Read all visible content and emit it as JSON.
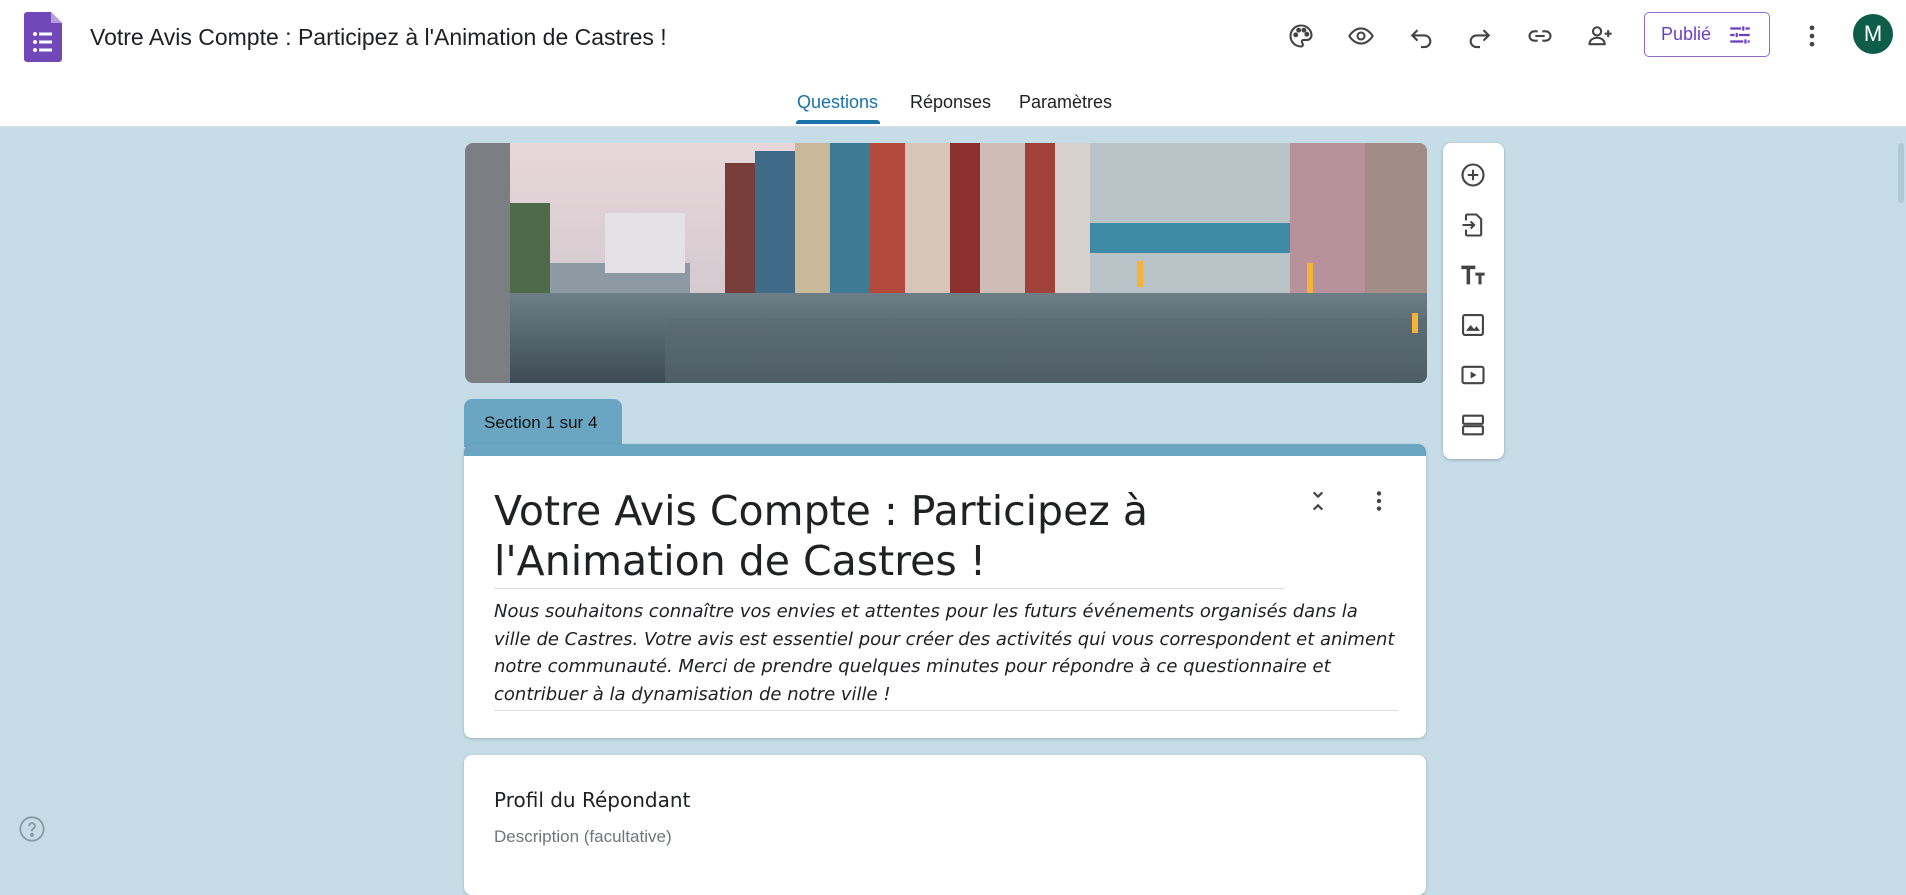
{
  "header": {
    "doc_title": "Votre Avis Compte : Participez à l'Animation de Castres !",
    "app_icon": "google-forms-icon",
    "toolbar_icons": [
      "palette-icon",
      "eye-icon",
      "undo-icon",
      "redo-icon",
      "link-icon",
      "add-person-icon"
    ],
    "publish_label": "Publié",
    "more_icon": "more-vert-icon",
    "avatar_letter": "M"
  },
  "tabs": [
    {
      "label": "Questions",
      "active": true
    },
    {
      "label": "Réponses",
      "active": false
    },
    {
      "label": "Paramètres",
      "active": false
    }
  ],
  "section_tab": "Section 1 sur 4",
  "form": {
    "title": "Votre Avis Compte : Participez à l'Animation de Castres !",
    "description": "Nous souhaitons connaître vos envies et attentes pour les futurs événements organisés dans la ville de Castres. Votre avis est essentiel pour créer des activités qui vous correspondent et animent notre communauté. Merci de prendre quelques minutes pour répondre à ce questionnaire et contribuer à la dynamisation de notre ville !"
  },
  "section2": {
    "title": "Profil du Répondant",
    "description_placeholder": "Description (facultative)"
  },
  "floating_toolbar": [
    "add-question-icon",
    "import-questions-icon",
    "add-title-icon",
    "add-image-icon",
    "add-video-icon",
    "add-section-icon"
  ],
  "colors": {
    "accent": "#6aa6c2",
    "background": "#c6dde8",
    "active_tab": "#1a73a8",
    "publish": "#6b3fc4",
    "avatar": "#0e5c4a"
  }
}
